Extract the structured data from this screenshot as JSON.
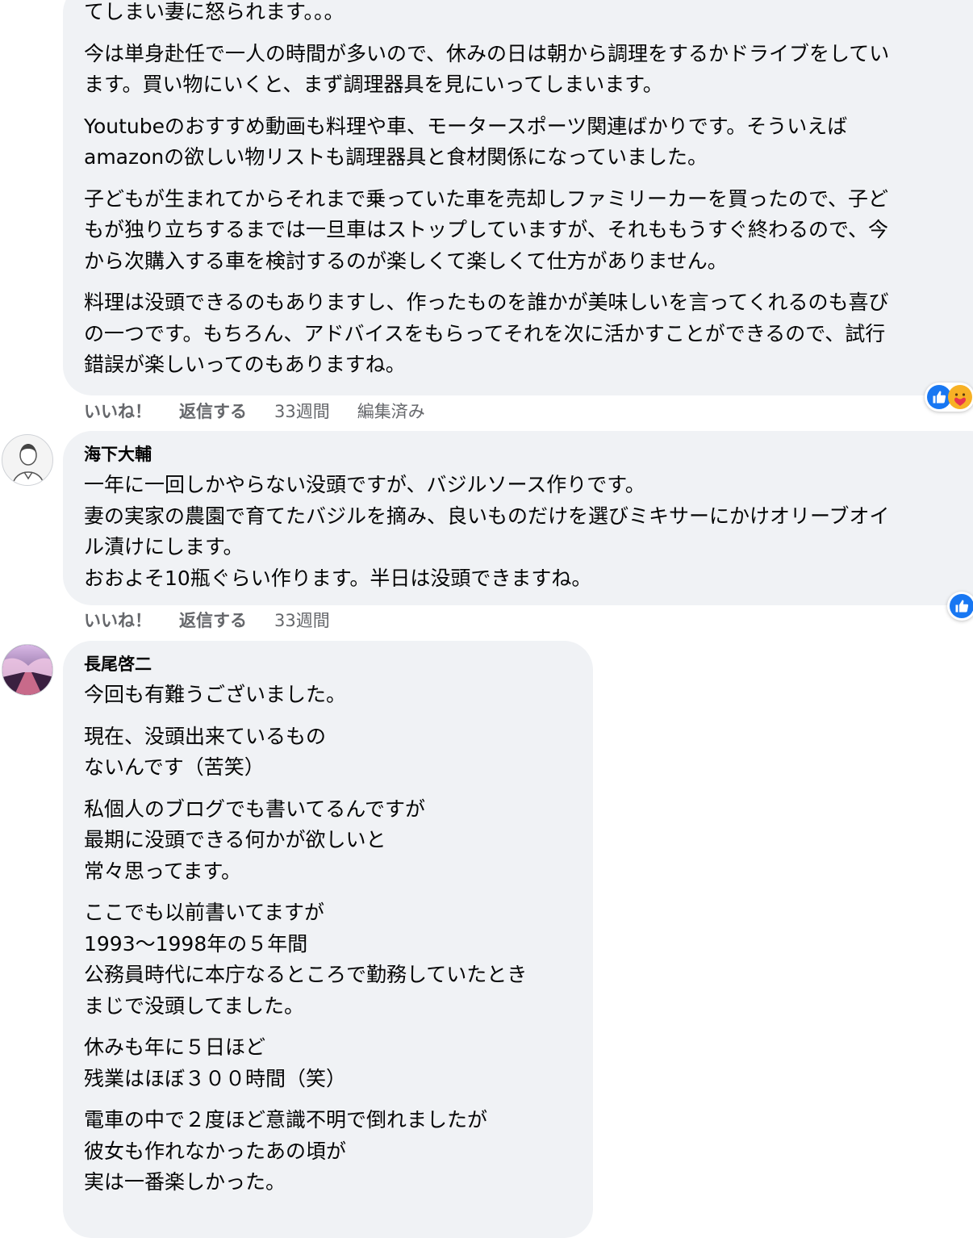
{
  "comments": [
    {
      "paragraphs": [
        [
          "てしまい妻に怒られます。。。"
        ],
        [
          "今は単身赴任で一人の時間が多いので、休みの日は朝から調理をするかドライブをしてい",
          "ます。買い物にいくと、まず調理器具を見にいってしまいます。"
        ],
        [
          "Youtubeのおすすめ動画も料理や車、モータースポーツ関連ばかりです。そういえば",
          "amazonの欲しい物リストも調理器具と食材関係になっていました。"
        ],
        [
          "子どもが生まれてからそれまで乗っていた車を売却しファミリーカーを買ったので、子ど",
          "もが独り立ちするまでは一旦車はストップしていますが、それももうすぐ終わるので、今",
          "から次購入する車を検討するのが楽しくて楽しくて仕方がありません。"
        ],
        [
          "料理は没頭できるのもありますし、作ったものを誰かが美味しいを言ってくれるのも喜び",
          "の一つです。もちろん、アドバイスをもらってそれを次に活かすことができるので、試行",
          "錯誤が楽しいってのもありますね。"
        ]
      ],
      "like_label": "いいね！",
      "reply_label": "返信する",
      "time": "33週間",
      "edited": "編集済み"
    },
    {
      "author": "海下大輔",
      "paragraphs": [
        [
          "一年に一回しかやらない没頭ですが、バジルソース作りです。",
          "妻の実家の農園で育てたバジルを摘み、良いものだけを選びミキサーにかけオリーブオイ",
          "ル漬けにします。",
          "おおよそ10瓶ぐらい作ります。半日は没頭できますね。"
        ]
      ],
      "like_label": "いいね！",
      "reply_label": "返信する",
      "time": "33週間"
    },
    {
      "author": "長尾啓二",
      "paragraphs": [
        [
          "今回も有難うございました。"
        ],
        [
          "現在、没頭出来ているもの",
          "ないんです（苦笑）"
        ],
        [
          "私個人のブログでも書いてるんですが",
          "最期に没頭できる何かが欲しいと",
          "常々思ってます。"
        ],
        [
          "ここでも以前書いてますが",
          "1993〜1998年の５年間",
          "公務員時代に本庁なるところで勤務していたとき",
          "まじで没頭してました。"
        ],
        [
          "休みも年に５日ほど",
          "残業はほぼ３００時間（笑）"
        ],
        [
          "電車の中で２度ほど意識不明で倒れましたが",
          "彼女も作れなかったあの頃が",
          "実は一番楽しかった。"
        ]
      ]
    }
  ],
  "colors": {
    "bubble": "#f0f2f5",
    "meta": "#65676b",
    "like_blue": "#1877f2"
  },
  "icons": [
    "like-icon",
    "care-icon"
  ]
}
